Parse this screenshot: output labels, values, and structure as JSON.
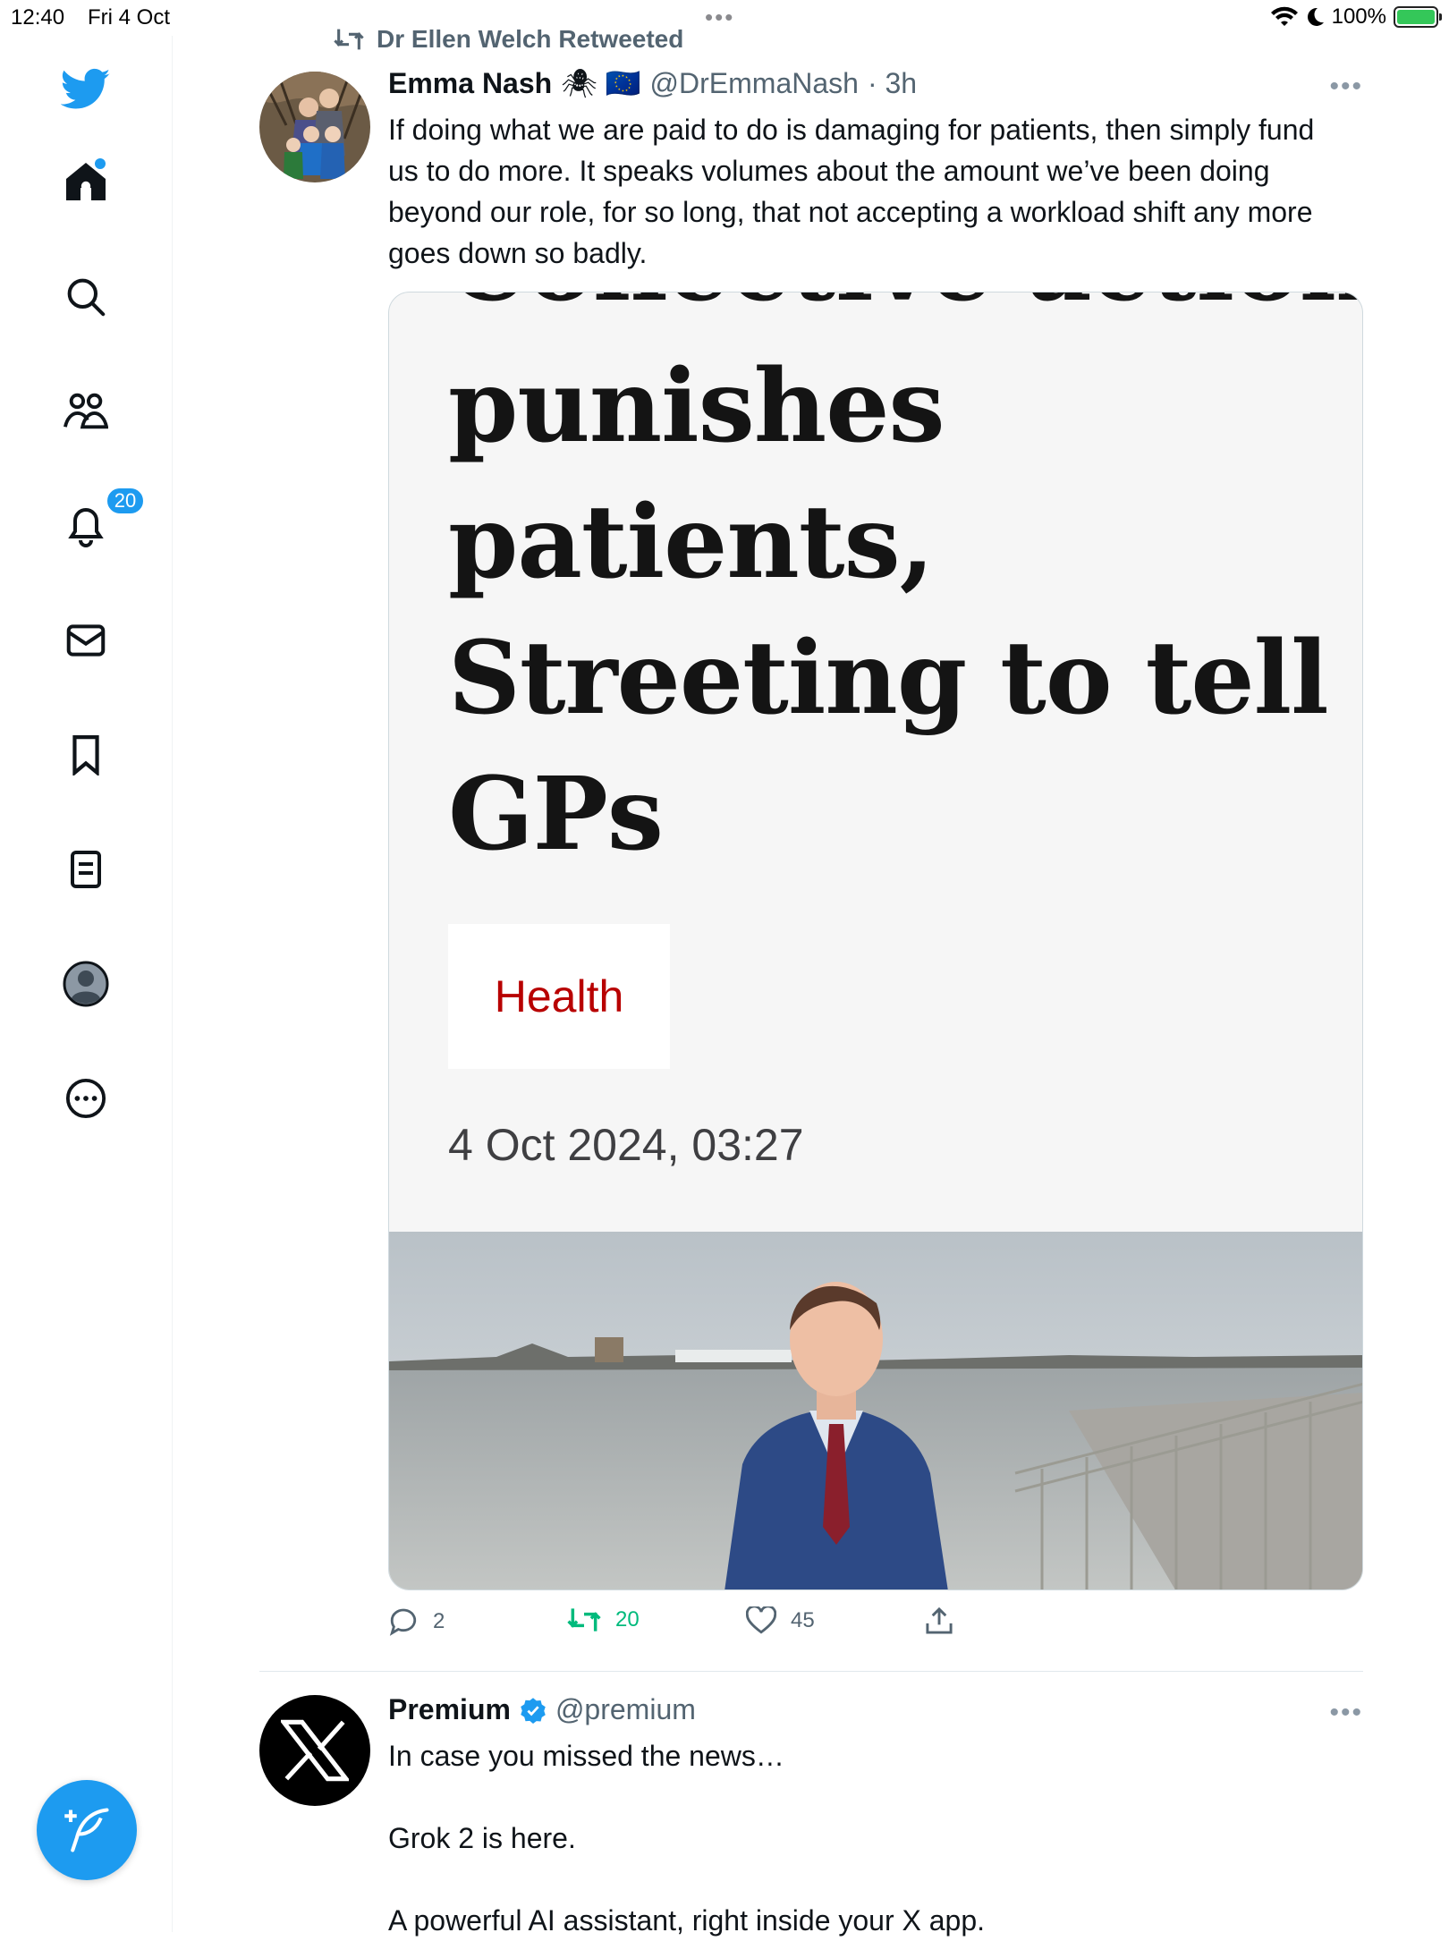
{
  "status_bar": {
    "time": "12:40",
    "date": "Fri 4 Oct",
    "battery": "100%"
  },
  "sidebar": {
    "notifications_count": "20",
    "items": [
      {
        "name": "twitter-logo-icon"
      },
      {
        "name": "home-icon"
      },
      {
        "name": "search-icon"
      },
      {
        "name": "communities-icon"
      },
      {
        "name": "notifications-icon"
      },
      {
        "name": "messages-icon"
      },
      {
        "name": "bookmarks-icon"
      },
      {
        "name": "lists-icon"
      },
      {
        "name": "profile-icon"
      },
      {
        "name": "more-icon"
      }
    ]
  },
  "tweets": [
    {
      "retweeted_by": "Dr Ellen Welch Retweeted",
      "display_name": "Emma Nash",
      "emoji": "🕷 🇪🇺",
      "handle": "@DrEmmaNash",
      "time": "· 3h",
      "text": "If doing what we are paid to do is damaging for patients, then simply fund us to do more. It speaks volumes about the amount we’ve been doing beyond our role, for so long, that not accepting a workload shift any more goes down so badly.",
      "card": {
        "headline_cut": "Collective action",
        "headline_lines": [
          "punishes",
          "patients,",
          "Streeting to tell",
          "GPs"
        ],
        "category": "Health",
        "date": "4 Oct 2024, 03:27"
      },
      "actions": {
        "replies": "2",
        "retweets": "20",
        "likes": "45"
      }
    },
    {
      "display_name": "Premium",
      "handle": "@premium",
      "text_lines": [
        "In case you missed the news…",
        "Grok 2 is here.",
        "A powerful AI assistant, right inside your X app."
      ]
    }
  ],
  "colors": {
    "accent": "#1d9bf0",
    "retweet_green": "#00ba7c",
    "secondary_text": "#536471",
    "category_red": "#b80000"
  }
}
